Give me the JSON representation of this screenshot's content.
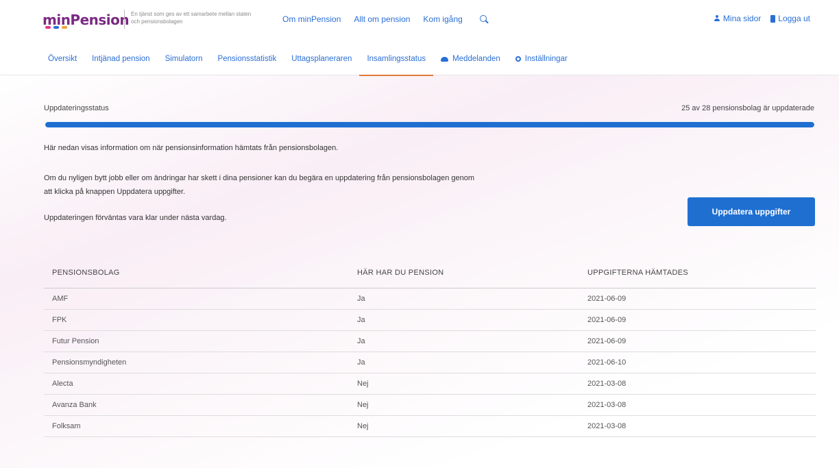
{
  "header": {
    "logo": "minPension",
    "logo_dot_colors": [
      "#e6338c",
      "#2a6fd6",
      "#f2a33a"
    ],
    "tagline": "En tjänst som ges av ett samarbete mellan staten och pensionsbolagen",
    "nav": [
      "Om minPension",
      "Allt om pension",
      "Kom igång"
    ],
    "my_pages": "Mina sidor",
    "logout": "Logga ut"
  },
  "subnav": {
    "tabs": [
      "Översikt",
      "Intjänad pension",
      "Simulatorn",
      "Pensionsstatistik",
      "Uttagsplaneraren",
      "Insamlingsstatus",
      "Meddelanden",
      "Inställningar"
    ],
    "active": "Insamlingsstatus",
    "accent_color": "#e07b3a"
  },
  "status": {
    "label": "Uppdateringsstatus",
    "summary": "25 av 28 pensionsbolag är uppdaterade",
    "progress_fraction": 1.0
  },
  "info": {
    "p1": "Här nedan visas information om när pensionsinformation hämtats från pensionsbolagen.",
    "p2": "Om du nyligen bytt jobb eller om ändringar har skett i dina pensioner kan du begära en uppdatering från pensionsbolagen genom att klicka på knappen Uppdatera uppgifter.",
    "p3": "Uppdateringen förväntas vara klar under nästa vardag."
  },
  "update_button": "Uppdatera uppgifter",
  "table": {
    "headers": [
      "PENSIONSBOLAG",
      "HÄR HAR DU PENSION",
      "UPPGIFTERNA HÄMTADES"
    ],
    "rows": [
      [
        "AMF",
        "Ja",
        "2021-06-09"
      ],
      [
        "FPK",
        "Ja",
        "2021-06-09"
      ],
      [
        "Futur Pension",
        "Ja",
        "2021-06-09"
      ],
      [
        "Pensionsmyndigheten",
        "Ja",
        "2021-06-10"
      ],
      [
        "Alecta",
        "Nej",
        "2021-03-08"
      ],
      [
        "Avanza Bank",
        "Nej",
        "2021-03-08"
      ],
      [
        "Folksam",
        "Nej",
        "2021-03-08"
      ]
    ]
  },
  "colors": {
    "primary": "#1f6fd1",
    "link": "#2a6fd6",
    "brand": "#7a2a82"
  }
}
